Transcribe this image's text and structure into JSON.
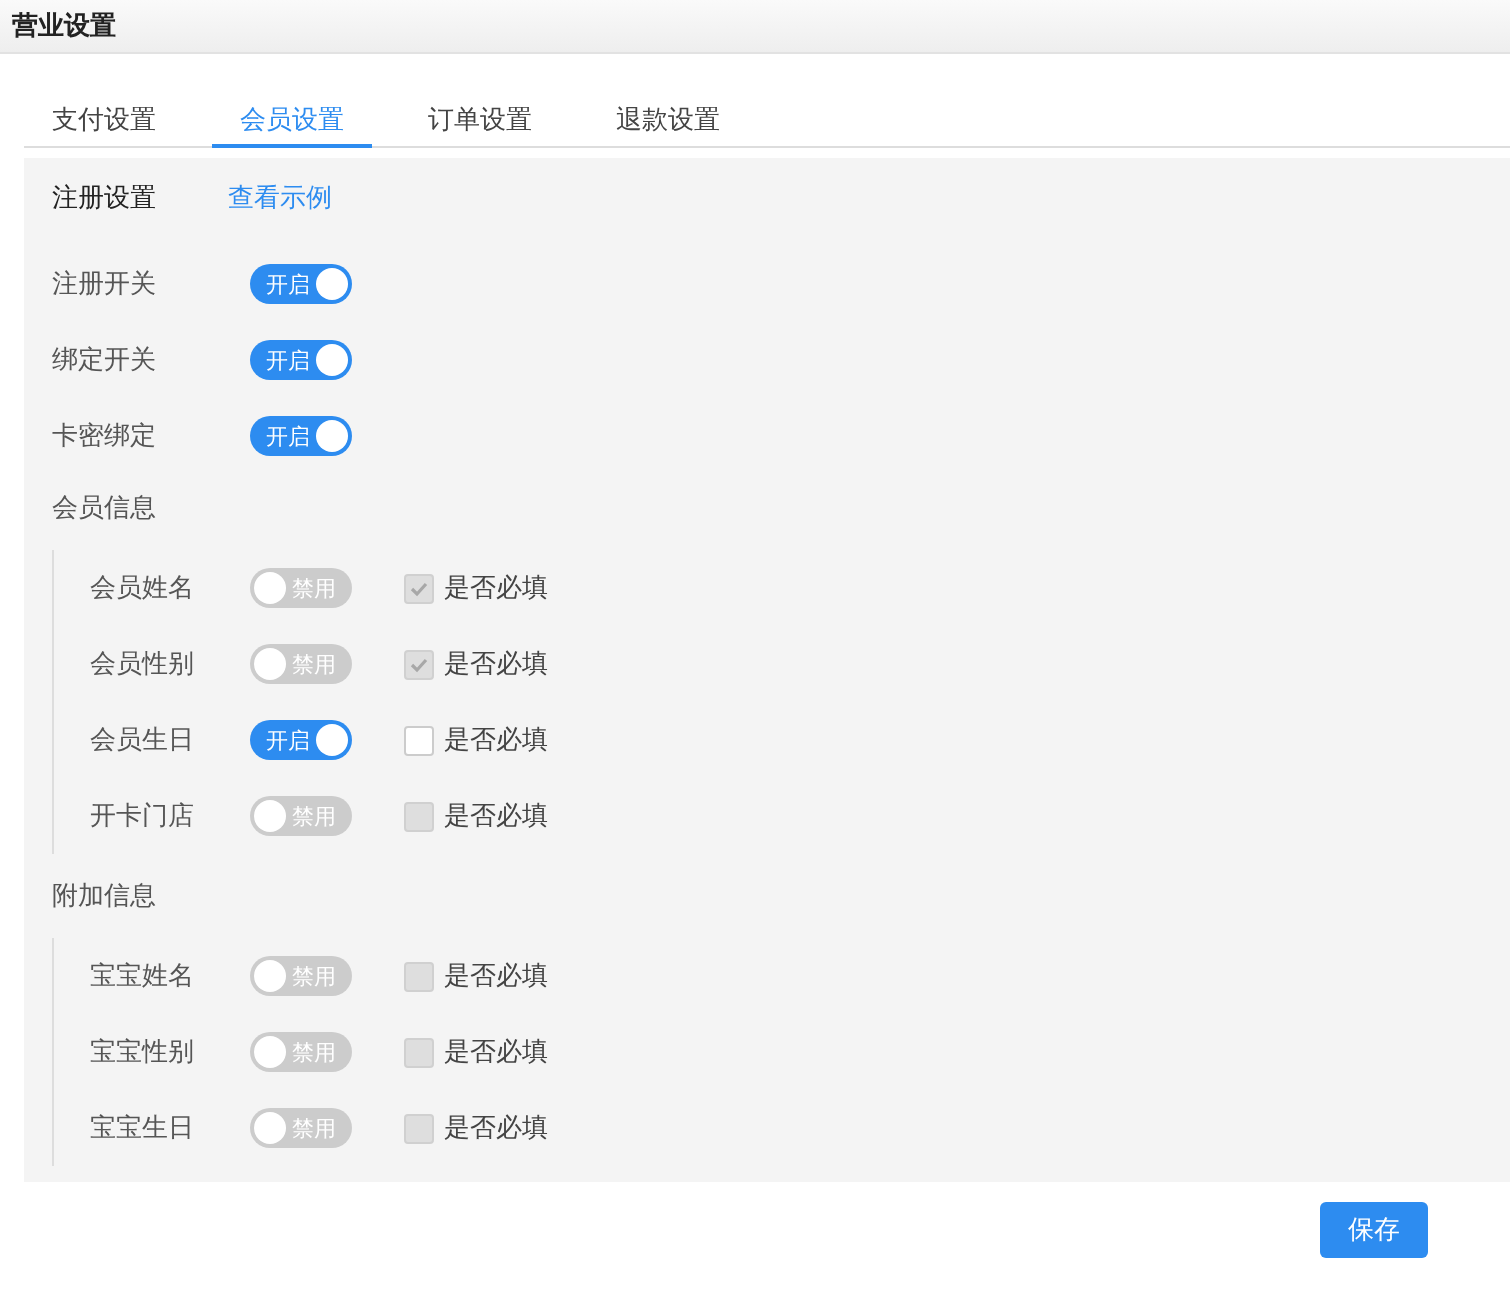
{
  "window": {
    "title": "营业设置"
  },
  "tabs": [
    {
      "label": "支付设置",
      "selected": false
    },
    {
      "label": "会员设置",
      "selected": true
    },
    {
      "label": "订单设置",
      "selected": false
    },
    {
      "label": "退款设置",
      "selected": false
    }
  ],
  "section": {
    "title": "注册设置",
    "link": "查看示例"
  },
  "switches": [
    {
      "label": "注册开关",
      "on": true,
      "state_text": "开启"
    },
    {
      "label": "绑定开关",
      "on": true,
      "state_text": "开启"
    },
    {
      "label": "卡密绑定",
      "on": true,
      "state_text": "开启"
    }
  ],
  "groups": [
    {
      "title": "会员信息",
      "fields": [
        {
          "label": "会员姓名",
          "on": false,
          "state_text": "禁用",
          "required": {
            "label": "是否必填",
            "checked": true,
            "disabled": true
          }
        },
        {
          "label": "会员性别",
          "on": false,
          "state_text": "禁用",
          "required": {
            "label": "是否必填",
            "checked": true,
            "disabled": true
          }
        },
        {
          "label": "会员生日",
          "on": true,
          "state_text": "开启",
          "required": {
            "label": "是否必填",
            "checked": false,
            "disabled": false
          }
        },
        {
          "label": "开卡门店",
          "on": false,
          "state_text": "禁用",
          "required": {
            "label": "是否必填",
            "checked": false,
            "disabled": true
          }
        }
      ]
    },
    {
      "title": "附加信息",
      "fields": [
        {
          "label": "宝宝姓名",
          "on": false,
          "state_text": "禁用",
          "required": {
            "label": "是否必填",
            "checked": false,
            "disabled": true
          }
        },
        {
          "label": "宝宝性别",
          "on": false,
          "state_text": "禁用",
          "required": {
            "label": "是否必填",
            "checked": false,
            "disabled": true
          }
        },
        {
          "label": "宝宝生日",
          "on": false,
          "state_text": "禁用",
          "required": {
            "label": "是否必填",
            "checked": false,
            "disabled": true
          }
        }
      ]
    }
  ],
  "buttons": [
    {
      "label": "保存"
    }
  ]
}
